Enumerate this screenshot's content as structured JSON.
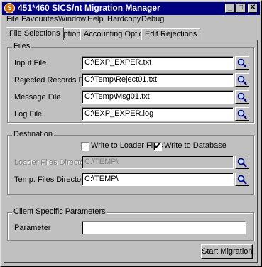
{
  "window": {
    "title": "451*460 SICS/nt Migration Manager",
    "icon_text": "S"
  },
  "menu": [
    {
      "label": "File"
    },
    {
      "label": "Favourites"
    },
    {
      "label": "Window"
    },
    {
      "label": "Help"
    },
    {
      "label": "Hardcopy"
    },
    {
      "label": "Debug"
    }
  ],
  "tabs": [
    {
      "label": "File Selections",
      "active": true
    },
    {
      "label": "Options"
    },
    {
      "label": "Accounting Options"
    },
    {
      "label": "Edit Rejections"
    }
  ],
  "files_group": {
    "label": "Files",
    "input_file": {
      "label": "Input File",
      "value": "C:\\EXP_EXPER.txt"
    },
    "rejected_file": {
      "label": "Rejected Records File",
      "value": "C:\\Temp\\Reject01.txt"
    },
    "message_file": {
      "label": "Message File",
      "value": "C:\\Temp\\Msg01.txt"
    },
    "log_file": {
      "label": "Log File",
      "value": "C:\\EXP_EXPER.log"
    }
  },
  "destination_group": {
    "label": "Destination",
    "write_loader": {
      "label": "Write to Loader Files",
      "checked": false
    },
    "write_db": {
      "label": "Write to Database",
      "checked": true,
      "mark": "✔"
    },
    "loader_dir": {
      "label": "Loader Files Directory",
      "value": "C:\\TEMP\\"
    },
    "temp_dir": {
      "label": "Temp. Files Directory",
      "value": "C:\\TEMP\\"
    }
  },
  "client_group": {
    "label": "Client Specific Parameters",
    "parameter": {
      "label": "Parameter",
      "value": ""
    }
  },
  "start_button": {
    "label": "Start Migration"
  },
  "titlebar_buttons": {
    "minimize": "_",
    "maximize": "□",
    "close": "✕"
  }
}
